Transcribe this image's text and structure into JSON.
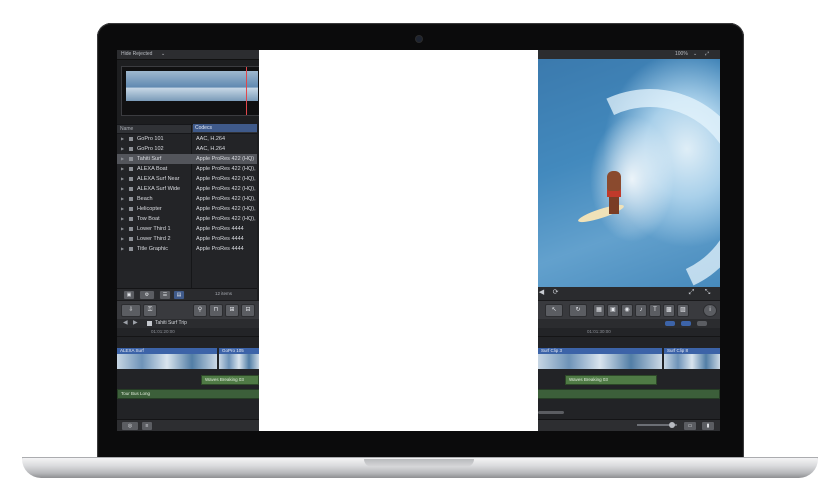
{
  "app": {
    "filter_label": "Hide Rejected",
    "zoom": "100%",
    "item_count": "12 items"
  },
  "browser": {
    "columns": [
      "Name",
      "Codecs"
    ],
    "rows": [
      {
        "name": "GoPro 101",
        "codec": "AAC, H.264",
        "selected": false
      },
      {
        "name": "GoPro 102",
        "codec": "AAC, H.264",
        "selected": false
      },
      {
        "name": "Tahiti Surf",
        "codec": "Apple ProRes 422 (HQ)",
        "selected": true
      },
      {
        "name": "ALEXA Boat",
        "codec": "Apple ProRes 422 (HQ),",
        "selected": false
      },
      {
        "name": "ALEXA Surf Near",
        "codec": "Apple ProRes 422 (HQ),",
        "selected": false
      },
      {
        "name": "ALEXA Surf Wide",
        "codec": "Apple ProRes 422 (HQ),",
        "selected": false
      },
      {
        "name": "Beach",
        "codec": "Apple ProRes 422 (HQ),",
        "selected": false
      },
      {
        "name": "Helicopter",
        "codec": "Apple ProRes 422 (HQ),",
        "selected": false
      },
      {
        "name": "Tow Boat",
        "codec": "Apple ProRes 422 (HQ),",
        "selected": false
      },
      {
        "name": "Lower Third 1",
        "codec": "Apple ProRes 4444",
        "selected": false
      },
      {
        "name": "Lower Third 2",
        "codec": "Apple ProRes 4444",
        "selected": false
      },
      {
        "name": "Title Graphic",
        "codec": "Apple ProRes 4444",
        "selected": false
      }
    ]
  },
  "timeline": {
    "project_name": "Tahiti Surf Trip",
    "ruler": [
      "01:01:20:00",
      "01:01:30:00"
    ],
    "clips": {
      "alexa_surf": "ALEXA Surf",
      "gopro_105": "GoPro 105",
      "surf_clip_3": "Surf Clip 3",
      "surf_clip_8": "Surf Clip 8",
      "waves_left": "Waves Breaking 03",
      "waves_right": "Waves Breaking 03",
      "music": "Tour Bus Long"
    }
  },
  "colors": {
    "selection": "#3f5a8a",
    "video_clip": "#3c63a8",
    "audio_clip": "#4f7a45",
    "playhead": "#e0474c"
  }
}
